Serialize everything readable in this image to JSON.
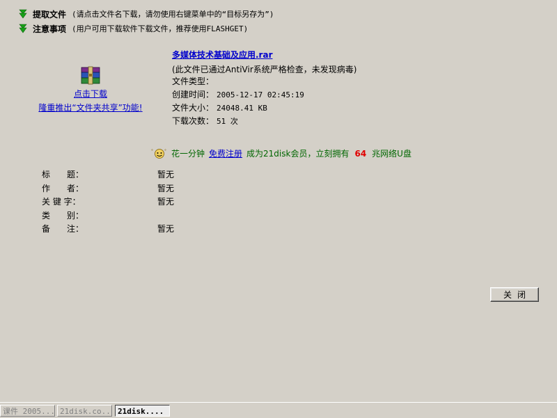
{
  "notices": [
    {
      "title": "提取文件",
      "desc": "(请点击文件名下载，请勿使用右键菜单中的“目标另存为”)"
    },
    {
      "title": "注意事项",
      "desc": "(用户可用下载软件下载文件，推荐使用FLASHGET)"
    }
  ],
  "download": {
    "icon": "winrar-archive-icon",
    "click_label": "点击下载",
    "share_label": "隆重推出“文件夹共享”功能!"
  },
  "file": {
    "name": "多媒体技术基础及应用.rar",
    "scan_note": "(此文件已通过AntiVir系统严格检查，未发现病毒)",
    "type_label": "文件类型：",
    "type_value": "",
    "created_label": "创建时间：",
    "created_value": "2005-12-17 02:45:19",
    "size_label": "文件大小：",
    "size_value": "24048.41 KB",
    "downloads_label": "下载次数：",
    "downloads_value": "51 次"
  },
  "promo": {
    "icon": "smiley-icon",
    "prefix": "花一分钟",
    "link": "免费注册",
    "middle": "成为21disk会员，立刻拥有",
    "amount": "64",
    "suffix": "兆网络U盘",
    "amount_color": "#e00000",
    "text_color": "#006600"
  },
  "meta": [
    {
      "key": "标　　题：",
      "value": "暂无"
    },
    {
      "key": "作　　者：",
      "value": "暂无"
    },
    {
      "key": "关 键 字：",
      "value": "暂无"
    },
    {
      "key": "类　　别：",
      "value": ""
    },
    {
      "key": "备　　注：",
      "value": "暂无"
    }
  ],
  "close_label": "关闭",
  "taskbar": [
    {
      "label": "课件 2005..."
    },
    {
      "label": "21disk.co..."
    },
    {
      "label": "21disk...."
    }
  ]
}
